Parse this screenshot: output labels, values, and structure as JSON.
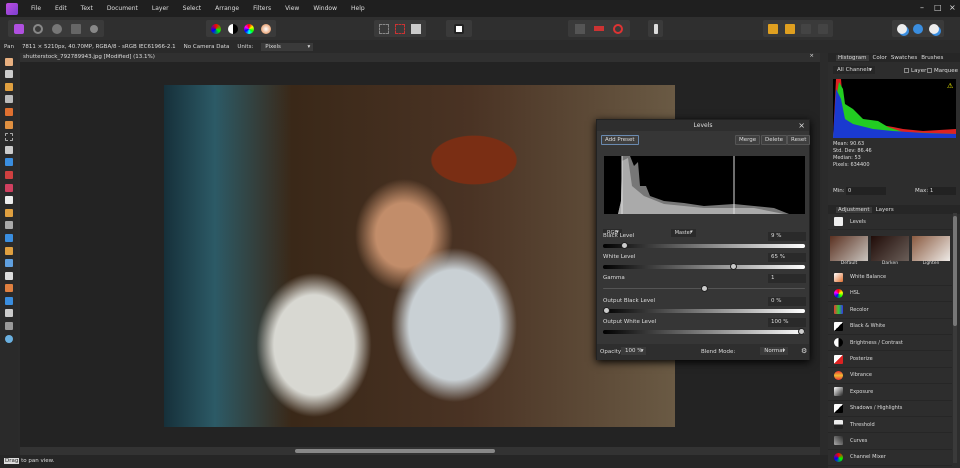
{
  "menu": [
    "File",
    "Edit",
    "Text",
    "Document",
    "Layer",
    "Select",
    "Arrange",
    "Filters",
    "View",
    "Window",
    "Help"
  ],
  "context": {
    "tool": "Pan",
    "info": "7811 × 5210px, 40.70MP, RGBA/8 - sRGB IEC61966-2.1",
    "camera": "No Camera Data",
    "units_label": "Units:",
    "units_value": "Pixels"
  },
  "document": {
    "tab": "shutterstock_792789943.jpg [Modified] (13.1%)"
  },
  "status": {
    "key": "Drag",
    "text": " to pan view."
  },
  "right": {
    "tabs": [
      "Histogram",
      "Color",
      "Swatches",
      "Brushes"
    ],
    "channels": "All Channels",
    "layer_label": "Layer",
    "marquee_label": "Marquee",
    "stats": [
      "Mean: 90.63",
      "Std. Dev: 86.46",
      "Median: 53",
      "Pixels: 634400"
    ],
    "min_label": "Min:",
    "min_value": "0",
    "max_label": "Max:",
    "max_value": "1",
    "adj_tabs": [
      "Adjustment",
      "Layers"
    ],
    "levels_label": "Levels",
    "presets": [
      "Default",
      "Darken",
      "Lighten"
    ],
    "adjustments": [
      "White Balance",
      "HSL",
      "Recolor",
      "Black & White",
      "Brightness / Contrast",
      "Posterize",
      "Vibrance",
      "Exposure",
      "Shadows / Highlights",
      "Threshold",
      "Curves",
      "Channel Mixer"
    ]
  },
  "levels": {
    "title": "Levels",
    "add_preset": "Add Preset",
    "merge": "Merge",
    "delete": "Delete",
    "reset": "Reset",
    "channel": "RGB",
    "mode": "Master",
    "black_level_label": "Black Level",
    "black_level": "9 %",
    "black_level_value": 9,
    "white_level_label": "White Level",
    "white_level": "65 %",
    "white_level_value": 65,
    "gamma_label": "Gamma",
    "gamma": "1",
    "output_black_label": "Output Black Level",
    "output_black": "0 %",
    "output_white_label": "Output White Level",
    "output_white": "100 %",
    "opacity_label": "Opacity:",
    "opacity": "100 %",
    "blend_label": "Blend Mode:",
    "blend": "Normal"
  }
}
